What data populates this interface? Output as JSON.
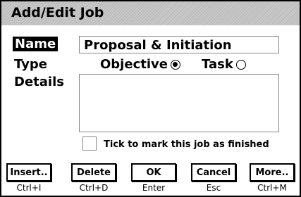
{
  "dialog": {
    "title": "Add/Edit Job"
  },
  "form": {
    "name_label": "Name",
    "name_value": "Proposal & Initiation",
    "type_label": "Type",
    "type_options": [
      {
        "label": "Objective",
        "checked": true
      },
      {
        "label": "Task",
        "checked": false
      }
    ],
    "details_label": "Details",
    "details_value": "",
    "finished_checkbox_label": "Tick to mark this job as finished",
    "finished_checked": false
  },
  "buttons": [
    {
      "label": "Insert..",
      "shortcut": "Ctrl+I"
    },
    {
      "label": "Delete",
      "shortcut": "Ctrl+D"
    },
    {
      "label": "OK",
      "shortcut": "Enter"
    },
    {
      "label": "Cancel",
      "shortcut": "Esc"
    },
    {
      "label": "More..",
      "shortcut": "Ctrl+M"
    }
  ]
}
